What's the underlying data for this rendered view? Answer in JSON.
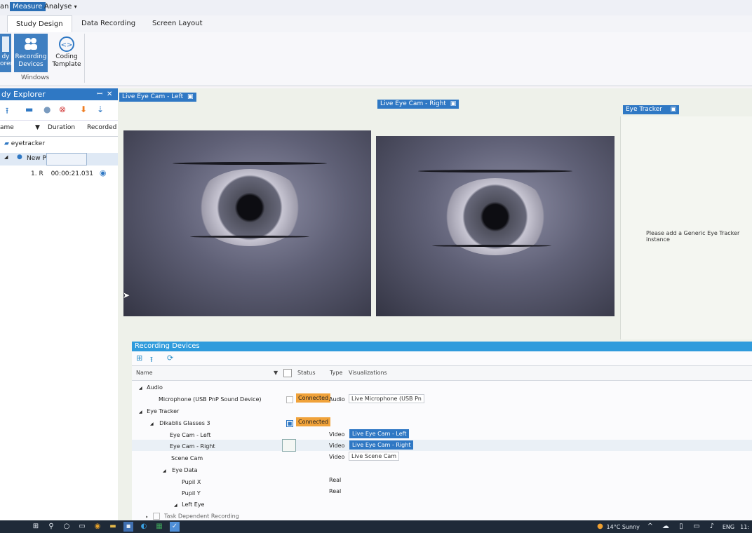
{
  "menubar": {
    "items": [
      "an",
      "Measure",
      "Analyse"
    ],
    "analyse_suffix": "▾"
  },
  "ribbon_tabs": [
    "Study Design",
    "Data Recording",
    "Screen Layout"
  ],
  "ribbon": {
    "buttons": [
      {
        "label": "dy\norer"
      },
      {
        "label": "Recording\nDevices"
      },
      {
        "label": "Coding\nTemplate"
      }
    ],
    "group_label": "Windows"
  },
  "explorer": {
    "title": "dy Explorer",
    "pin": "ꟷ",
    "close": "✕",
    "columns": [
      "ame",
      "Duration",
      "Recorded"
    ],
    "tree": [
      {
        "label": "eyetracker"
      },
      {
        "label": "New P"
      },
      {
        "label": "1. R",
        "duration": "00:00:21.031"
      }
    ]
  },
  "views": {
    "left_tab": "Live Eye Cam - Left",
    "right_tab": "Live Eye Cam - Right",
    "tracker_tab": "Eye Tracker",
    "tracker_message": "Please add a Generic Eye Tracker instance"
  },
  "recording_devices": {
    "title": "Recording Devices",
    "columns": [
      "Name",
      "Status",
      "Type",
      "Visualizations"
    ],
    "rows": [
      {
        "name": "Audio"
      },
      {
        "name": "Microphone (USB PnP Sound Device)",
        "status": "Connected",
        "type": "Audio",
        "vis": "Live Microphone (USB Pn"
      },
      {
        "name": "Eye Tracker"
      },
      {
        "name": "Dikablis Glasses 3",
        "status": "Connected"
      },
      {
        "name": "Eye Cam - Left",
        "type": "Video",
        "vis": "Live Eye Cam - Left"
      },
      {
        "name": "Eye Cam - Right",
        "type": "Video",
        "vis": "Live Eye Cam - Right"
      },
      {
        "name": "Scene Cam",
        "type": "Video",
        "vis": "Live Scene Cam"
      },
      {
        "name": "Eye Data"
      },
      {
        "name": "Pupil X",
        "type": "Real"
      },
      {
        "name": "Pupil Y",
        "type": "Real"
      },
      {
        "name": "Left Eye"
      },
      {
        "name": "Task Dependent Recording"
      }
    ]
  },
  "taskbar": {
    "weather": "14°C  Sunny",
    "lang": "ENG",
    "clock": "11:"
  },
  "colors": {
    "accent": "#2f78c4",
    "status_connected": "#f0a23a",
    "panel_header": "#2f9bdc"
  }
}
